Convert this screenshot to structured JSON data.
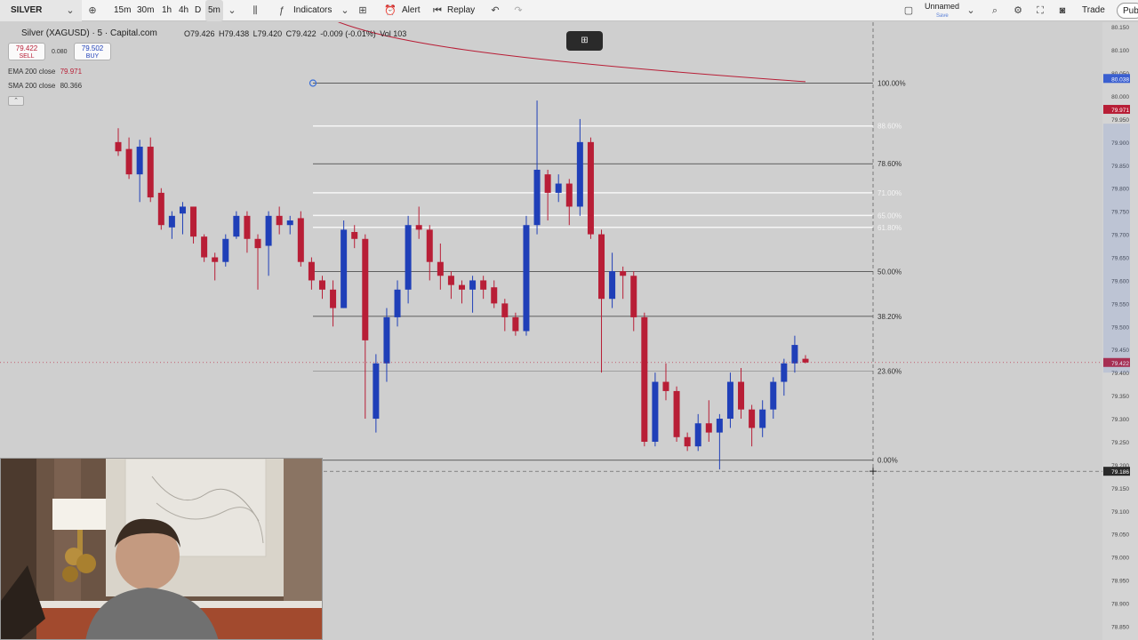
{
  "toolbar": {
    "symbol": "SILVER",
    "intervals": [
      "15m",
      "30m",
      "1h",
      "4h",
      "D",
      "5m"
    ],
    "indicators": "Indicators",
    "alert": "Alert",
    "replay": "Replay",
    "layout_name": "Unnamed",
    "layout_status": "Save",
    "trade": "Trade",
    "publish": "Pub"
  },
  "legend": {
    "title": "Silver (XAGUSD) · 5 · Capital.com",
    "o": "O79.426",
    "h": "H79.438",
    "l": "L79.420",
    "c": "C79.422",
    "chg": "-0.009 (-0.01%)",
    "vol": "Vol 103",
    "sell_price": "79.422",
    "sell_label": "SELL",
    "spread": "0.080",
    "buy_price": "79.502",
    "buy_label": "BUY",
    "ema_label": "EMA 200 close",
    "ema_value": "79.971",
    "sma_label": "SMA 200 close",
    "sma_value": "80.366"
  },
  "colors": {
    "up": "#1f3fb8",
    "down": "#b81e36",
    "background": "#cfcfcf",
    "ema": "#b81e36"
  },
  "chart_data": {
    "type": "candlestick",
    "candles": [
      {
        "o": 79.9,
        "c": 79.88,
        "h": 79.93,
        "l": 79.87
      },
      {
        "o": 79.885,
        "c": 79.83,
        "h": 79.91,
        "l": 79.82
      },
      {
        "o": 79.83,
        "c": 79.89,
        "h": 79.905,
        "l": 79.77
      },
      {
        "o": 79.89,
        "c": 79.78,
        "h": 79.91,
        "l": 79.77
      },
      {
        "o": 79.79,
        "c": 79.72,
        "h": 79.8,
        "l": 79.71
      },
      {
        "o": 79.715,
        "c": 79.74,
        "h": 79.75,
        "l": 79.69
      },
      {
        "o": 79.745,
        "c": 79.76,
        "h": 79.77,
        "l": 79.7
      },
      {
        "o": 79.76,
        "c": 79.695,
        "h": 79.76,
        "l": 79.68
      },
      {
        "o": 79.695,
        "c": 79.65,
        "h": 79.7,
        "l": 79.64
      },
      {
        "o": 79.65,
        "c": 79.64,
        "h": 79.66,
        "l": 79.6
      },
      {
        "o": 79.64,
        "c": 79.69,
        "h": 79.7,
        "l": 79.63
      },
      {
        "o": 79.695,
        "c": 79.74,
        "h": 79.75,
        "l": 79.69
      },
      {
        "o": 79.74,
        "c": 79.69,
        "h": 79.75,
        "l": 79.66
      },
      {
        "o": 79.69,
        "c": 79.67,
        "h": 79.7,
        "l": 79.58
      },
      {
        "o": 79.675,
        "c": 79.74,
        "h": 79.75,
        "l": 79.61
      },
      {
        "o": 79.74,
        "c": 79.72,
        "h": 79.76,
        "l": 79.7
      },
      {
        "o": 79.72,
        "c": 79.73,
        "h": 79.74,
        "l": 79.7
      },
      {
        "o": 79.735,
        "c": 79.64,
        "h": 79.75,
        "l": 79.63
      },
      {
        "o": 79.64,
        "c": 79.6,
        "h": 79.65,
        "l": 79.58
      },
      {
        "o": 79.6,
        "c": 79.58,
        "h": 79.61,
        "l": 79.56
      },
      {
        "o": 79.58,
        "c": 79.54,
        "h": 79.6,
        "l": 79.5
      },
      {
        "o": 79.54,
        "c": 79.71,
        "h": 79.73,
        "l": 79.54
      },
      {
        "o": 79.705,
        "c": 79.69,
        "h": 79.72,
        "l": 79.67
      },
      {
        "o": 79.69,
        "c": 79.47,
        "h": 79.7,
        "l": 79.3
      },
      {
        "o": 79.3,
        "c": 79.42,
        "h": 79.44,
        "l": 79.27
      },
      {
        "o": 79.42,
        "c": 79.52,
        "h": 79.54,
        "l": 79.38
      },
      {
        "o": 79.52,
        "c": 79.58,
        "h": 79.6,
        "l": 79.5
      },
      {
        "o": 79.58,
        "c": 79.72,
        "h": 79.74,
        "l": 79.55
      },
      {
        "o": 79.72,
        "c": 79.71,
        "h": 79.76,
        "l": 79.69
      },
      {
        "o": 79.71,
        "c": 79.64,
        "h": 79.72,
        "l": 79.6
      },
      {
        "o": 79.64,
        "c": 79.61,
        "h": 79.68,
        "l": 79.58
      },
      {
        "o": 79.61,
        "c": 79.59,
        "h": 79.62,
        "l": 79.56
      },
      {
        "o": 79.59,
        "c": 79.58,
        "h": 79.6,
        "l": 79.55
      },
      {
        "o": 79.58,
        "c": 79.6,
        "h": 79.61,
        "l": 79.53
      },
      {
        "o": 79.6,
        "c": 79.58,
        "h": 79.61,
        "l": 79.56
      },
      {
        "o": 79.585,
        "c": 79.55,
        "h": 79.6,
        "l": 79.54
      },
      {
        "o": 79.55,
        "c": 79.52,
        "h": 79.56,
        "l": 79.49
      },
      {
        "o": 79.52,
        "c": 79.49,
        "h": 79.53,
        "l": 79.48
      },
      {
        "o": 79.49,
        "c": 79.72,
        "h": 79.74,
        "l": 79.48
      },
      {
        "o": 79.72,
        "c": 79.84,
        "h": 79.99,
        "l": 79.7
      },
      {
        "o": 79.83,
        "c": 79.79,
        "h": 79.84,
        "l": 79.73
      },
      {
        "o": 79.79,
        "c": 79.81,
        "h": 79.83,
        "l": 79.77
      },
      {
        "o": 79.81,
        "c": 79.76,
        "h": 79.82,
        "l": 79.72
      },
      {
        "o": 79.76,
        "c": 79.9,
        "h": 79.95,
        "l": 79.74
      },
      {
        "o": 79.9,
        "c": 79.7,
        "h": 79.91,
        "l": 79.69
      },
      {
        "o": 79.7,
        "c": 79.56,
        "h": 79.71,
        "l": 79.4
      },
      {
        "o": 79.56,
        "c": 79.62,
        "h": 79.66,
        "l": 79.54
      },
      {
        "o": 79.62,
        "c": 79.61,
        "h": 79.63,
        "l": 79.56
      },
      {
        "o": 79.61,
        "c": 79.52,
        "h": 79.62,
        "l": 79.49
      },
      {
        "o": 79.52,
        "c": 79.25,
        "h": 79.53,
        "l": 79.24
      },
      {
        "o": 79.25,
        "c": 79.38,
        "h": 79.4,
        "l": 79.24
      },
      {
        "o": 79.38,
        "c": 79.36,
        "h": 79.42,
        "l": 79.34
      },
      {
        "o": 79.36,
        "c": 79.26,
        "h": 79.37,
        "l": 79.25
      },
      {
        "o": 79.26,
        "c": 79.24,
        "h": 79.27,
        "l": 79.23
      },
      {
        "o": 79.24,
        "c": 79.29,
        "h": 79.31,
        "l": 79.23
      },
      {
        "o": 79.29,
        "c": 79.27,
        "h": 79.34,
        "l": 79.25
      },
      {
        "o": 79.27,
        "c": 79.3,
        "h": 79.31,
        "l": 79.19
      },
      {
        "o": 79.3,
        "c": 79.38,
        "h": 79.4,
        "l": 79.28
      },
      {
        "o": 79.38,
        "c": 79.32,
        "h": 79.41,
        "l": 79.3
      },
      {
        "o": 79.32,
        "c": 79.28,
        "h": 79.33,
        "l": 79.24
      },
      {
        "o": 79.28,
        "c": 79.32,
        "h": 79.34,
        "l": 79.26
      },
      {
        "o": 79.32,
        "c": 79.38,
        "h": 79.39,
        "l": 79.3
      },
      {
        "o": 79.38,
        "c": 79.42,
        "h": 79.43,
        "l": 79.35
      },
      {
        "o": 79.42,
        "c": 79.46,
        "h": 79.48,
        "l": 79.4
      },
      {
        "o": 79.43,
        "c": 79.422,
        "h": 79.438,
        "l": 79.42
      }
    ],
    "ema_200": [
      80.02,
      79.971
    ],
    "fib_levels": [
      {
        "label": "100.00%",
        "price": 80.028
      },
      {
        "label": "88.60%",
        "price": 79.935
      },
      {
        "label": "78.60%",
        "price": 79.853
      },
      {
        "label": "71.00%",
        "price": 79.79
      },
      {
        "label": "65.00%",
        "price": 79.741
      },
      {
        "label": "61.80%",
        "price": 79.715
      },
      {
        "label": "50.00%",
        "price": 79.619
      },
      {
        "label": "38.20%",
        "price": 79.522
      },
      {
        "label": "23.60%",
        "price": 79.403
      },
      {
        "label": "0.00%",
        "price": 79.21
      }
    ],
    "price_axis_ticks": [
      "80.150",
      "80.100",
      "80.050",
      "80.000",
      "79.950",
      "79.900",
      "79.850",
      "79.800",
      "79.750",
      "79.700",
      "79.650",
      "79.600",
      "79.550",
      "79.500",
      "79.450",
      "79.400",
      "79.350",
      "79.300",
      "79.250",
      "79.200",
      "79.150",
      "79.100",
      "79.050",
      "79.000",
      "78.950",
      "78.900",
      "78.850"
    ],
    "last_price": "79.422",
    "ema_tag": "79.971",
    "top_tag": "80.038",
    "crosshair_price": "79.186",
    "ylim": [
      78.82,
      80.16
    ]
  }
}
